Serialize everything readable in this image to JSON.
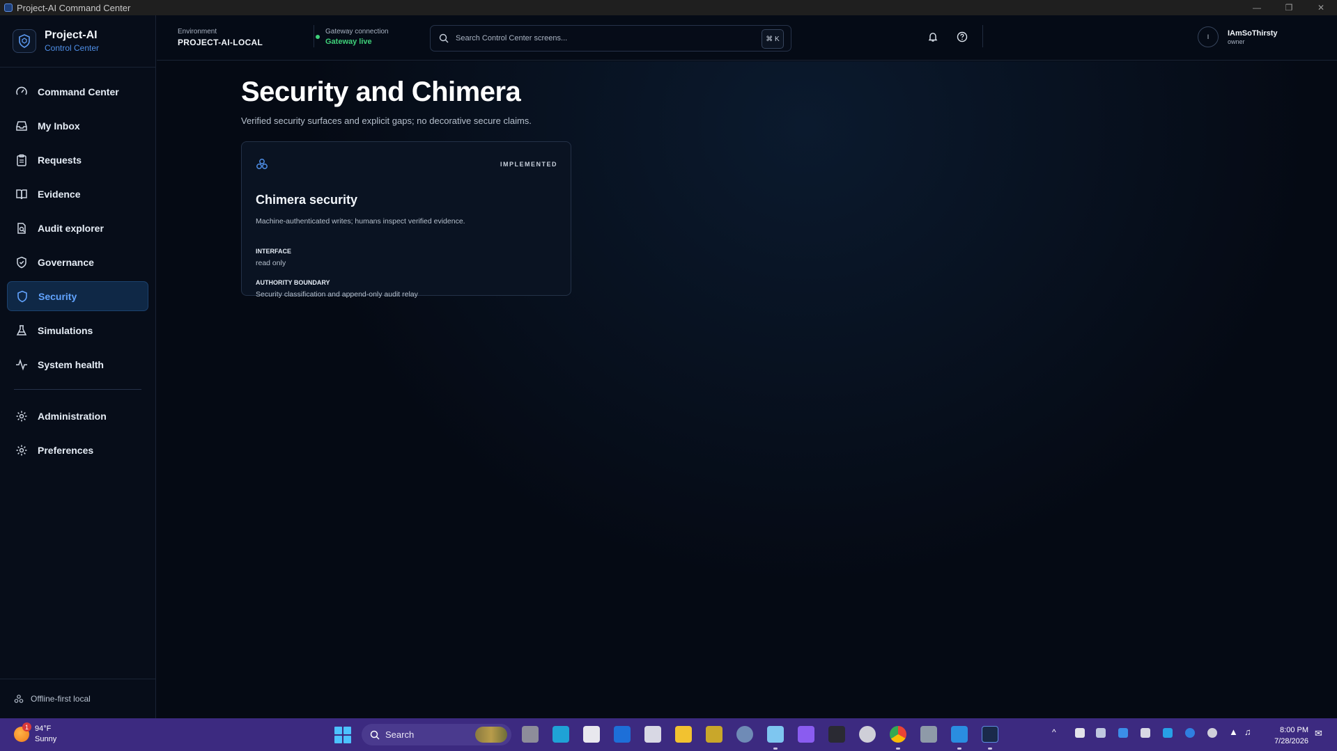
{
  "window": {
    "title": "Project-AI Command Center"
  },
  "brand": {
    "name": "Project-AI",
    "subtitle": "Control Center"
  },
  "sidebar": {
    "items": [
      {
        "label": "Command Center",
        "icon": "gauge-icon"
      },
      {
        "label": "My Inbox",
        "icon": "inbox-icon"
      },
      {
        "label": "Requests",
        "icon": "clipboard-icon"
      },
      {
        "label": "Evidence",
        "icon": "book-icon"
      },
      {
        "label": "Audit explorer",
        "icon": "audit-search-icon"
      },
      {
        "label": "Governance",
        "icon": "shield-check-icon"
      },
      {
        "label": "Security",
        "icon": "shield-icon",
        "active": true
      },
      {
        "label": "Simulations",
        "icon": "flask-icon"
      },
      {
        "label": "System health",
        "icon": "pulse-icon"
      }
    ],
    "secondary": [
      {
        "label": "Administration",
        "icon": "gear-icon"
      },
      {
        "label": "Preferences",
        "icon": "gear-icon"
      }
    ],
    "footer": "Offline-first local"
  },
  "header": {
    "environment_label": "Environment",
    "environment_value": "PROJECT-AI-LOCAL",
    "gateway_label": "Gateway connection",
    "gateway_value": "Gateway live",
    "search_placeholder": "Search Control Center screens...",
    "search_shortcut": "⌘ K",
    "user_initial": "I",
    "user_name": "IAmSoThirsty",
    "user_role": "owner"
  },
  "page": {
    "title": "Security and Chimera",
    "subtitle": "Verified security surfaces and explicit gaps; no decorative secure claims."
  },
  "card": {
    "badge": "IMPLEMENTED",
    "title": "Chimera security",
    "description": "Machine-authenticated writes; humans inspect verified evidence.",
    "fields": [
      {
        "label": "INTERFACE",
        "value": "read only"
      },
      {
        "label": "AUTHORITY BOUNDARY",
        "value": "Security classification and append-only audit relay"
      }
    ]
  },
  "taskbar": {
    "weather_temp": "94°F",
    "weather_cond": "Sunny",
    "weather_badge": "1",
    "search_label": "Search",
    "time": "8:00 PM",
    "date": "7/28/2026"
  },
  "colors": {
    "accent": "#4f8fe8",
    "active_nav_bg": "#0f2846",
    "gateway_live": "#3fd17a",
    "taskbar": "#3c2a80"
  }
}
